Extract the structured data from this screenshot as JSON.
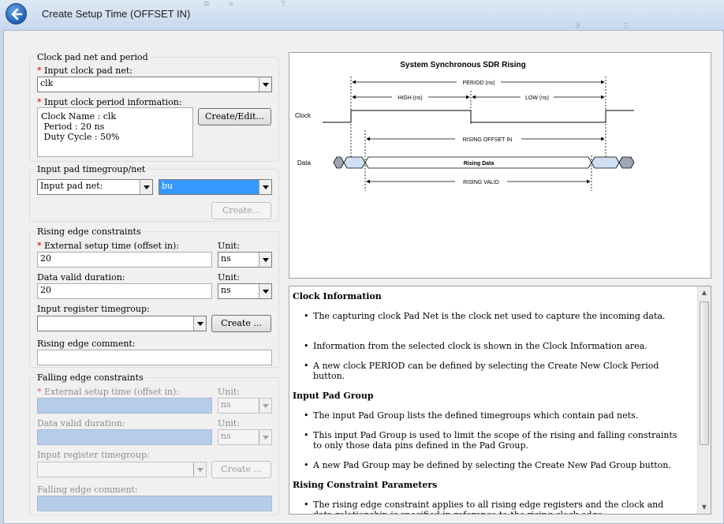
{
  "window": {
    "title": "Create Setup Time (OFFSET IN)",
    "faint_header_text": [
      "Φ",
      "≡",
      "?",
      "∂",
      "Ξ"
    ]
  },
  "clock_group": {
    "title": "Clock pad net and period",
    "pad_net_label": "Input clock pad net:",
    "pad_net_value": "clk",
    "period_label": "Input clock period information:",
    "period_info": "Clock Name : clk\n Period : 20 ns\n Duty Cycle : 50%",
    "create_edit_label": "Create/Edit..."
  },
  "input_pad_group": {
    "title": "Input pad timegroup/net",
    "type_value": "Input pad net:",
    "net_value": "bu",
    "create_label": "Create..."
  },
  "rising": {
    "title": "Rising edge constraints",
    "setup_label": "External setup time (offset in):",
    "setup_value": "20",
    "unit_label": "Unit:",
    "setup_unit": "ns",
    "valid_label": "Data valid duration:",
    "valid_value": "20",
    "valid_unit": "ns",
    "timegroup_label": "Input register timegroup:",
    "timegroup_value": "",
    "create_label": "Create ...",
    "comment_label": "Rising edge comment:",
    "comment_value": ""
  },
  "falling": {
    "title": "Falling edge constraints",
    "setup_label": "External setup time (offset in):",
    "setup_value": "",
    "unit_label": "Unit:",
    "setup_unit": "ns",
    "valid_label": "Data valid duration:",
    "valid_value": "",
    "valid_unit": "ns",
    "timegroup_label": "Input register timegroup:",
    "timegroup_value": "",
    "create_label": "Create ...",
    "comment_label": "Falling edge comment:",
    "comment_value": ""
  },
  "diagram": {
    "title": "System Synchronous SDR Rising",
    "period": "PERIOD (ns)",
    "high": "HIGH (ns)",
    "low": "LOW (ns)",
    "clock": "Clock",
    "offset_in": "RISING OFFSET IN",
    "data": "Data",
    "rising_data": "Rising Data",
    "valid": "RISING VALID"
  },
  "help": {
    "clock_heading": "Clock Information",
    "clock_b1": "The capturing clock Pad Net is the clock net used to capture the incoming data.",
    "clock_b2": "Information from the selected clock is shown in the Clock Information area.",
    "clock_b3": "A new clock PERIOD can be defined by selecting the Create New Clock Period button.",
    "pad_heading": "Input Pad Group",
    "pad_b1": "The input Pad Group lists the defined timegroups which contain pad nets.",
    "pad_b2": "This input Pad Group is used to limit the scope of the rising and falling constraints to only those data pins defined in the Pad Group.",
    "pad_b3": "A new Pad Group may be defined by selecting the Create New Pad Group button.",
    "rising_heading": "Rising Constraint Parameters",
    "rising_b1": "The rising edge constraint applies to all rising edge registers and the clock and data relationship is specified in reference to the rising clock edge."
  }
}
